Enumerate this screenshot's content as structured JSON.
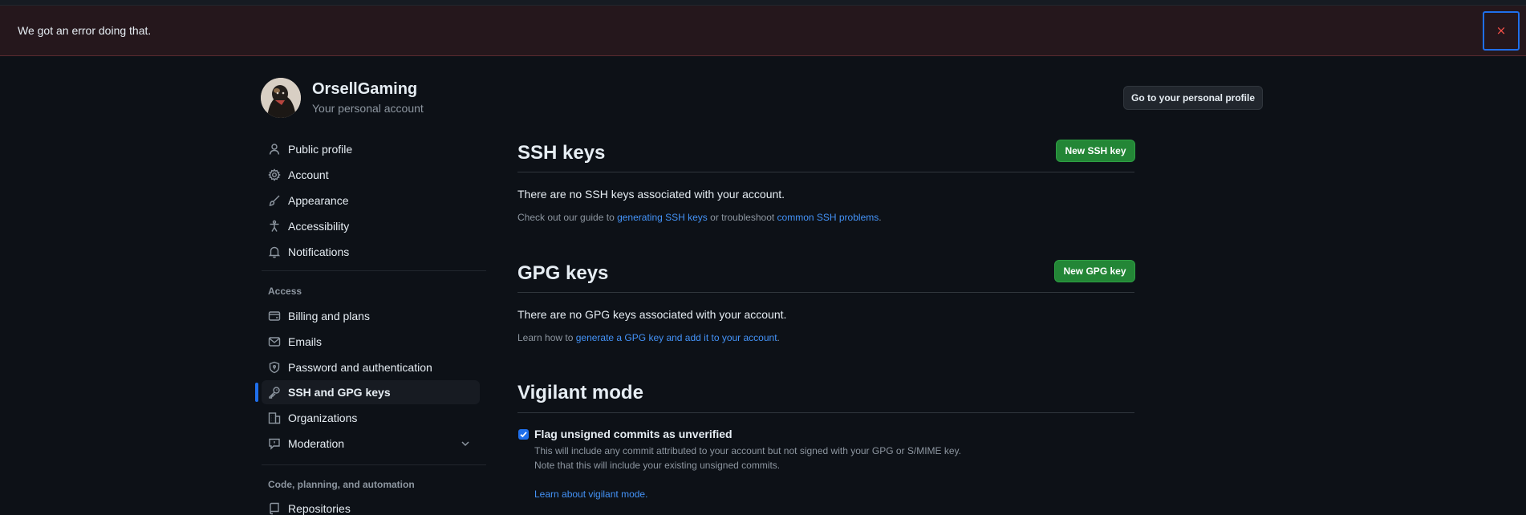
{
  "flash": {
    "message": "We got an error doing that.",
    "close_label": "×"
  },
  "header": {
    "username": "OrsellGaming",
    "subtitle": "Your personal account",
    "profile_button": "Go to your personal profile"
  },
  "sidebar": {
    "items": [
      {
        "label": "Public profile",
        "icon": "person-icon"
      },
      {
        "label": "Account",
        "icon": "gear-icon"
      },
      {
        "label": "Appearance",
        "icon": "paintbrush-icon"
      },
      {
        "label": "Accessibility",
        "icon": "accessibility-icon"
      },
      {
        "label": "Notifications",
        "icon": "bell-icon"
      }
    ],
    "access_heading": "Access",
    "access_items": [
      {
        "label": "Billing and plans",
        "icon": "credit-card-icon"
      },
      {
        "label": "Emails",
        "icon": "mail-icon"
      },
      {
        "label": "Password and authentication",
        "icon": "shield-lock-icon"
      },
      {
        "label": "SSH and GPG keys",
        "icon": "key-icon",
        "active": true
      },
      {
        "label": "Organizations",
        "icon": "organization-icon"
      },
      {
        "label": "Moderation",
        "icon": "report-icon"
      }
    ],
    "code_heading": "Code, planning, and automation",
    "code_items": [
      {
        "label": "Repositories",
        "icon": "repo-icon"
      }
    ]
  },
  "ssh": {
    "title": "SSH keys",
    "button": "New SSH key",
    "empty": "There are no SSH keys associated with your account.",
    "guide_prefix": "Check out our guide to ",
    "guide_link": "generating SSH keys",
    "guide_middle": " or troubleshoot ",
    "guide_link2": "common SSH problems",
    "guide_suffix": "."
  },
  "gpg": {
    "title": "GPG keys",
    "button": "New GPG key",
    "empty": "There are no GPG keys associated with your account.",
    "learn_prefix": "Learn how to ",
    "learn_link": "generate a GPG key and add it to your account",
    "learn_suffix": "."
  },
  "vigilant": {
    "title": "Vigilant mode",
    "checkbox_label": "Flag unsigned commits as unverified",
    "checked": true,
    "note1": "This will include any commit attributed to your account but not signed with your GPG or S/MIME key.",
    "note2": "Note that this will include your existing unsigned commits.",
    "learn_link": "Learn about vigilant mode."
  },
  "colors": {
    "background": "#0d1117",
    "accent": "#1f6feb",
    "green_button": "#238636",
    "link": "#4493f8",
    "flash_bg": "#25171c",
    "danger": "#f85149"
  }
}
